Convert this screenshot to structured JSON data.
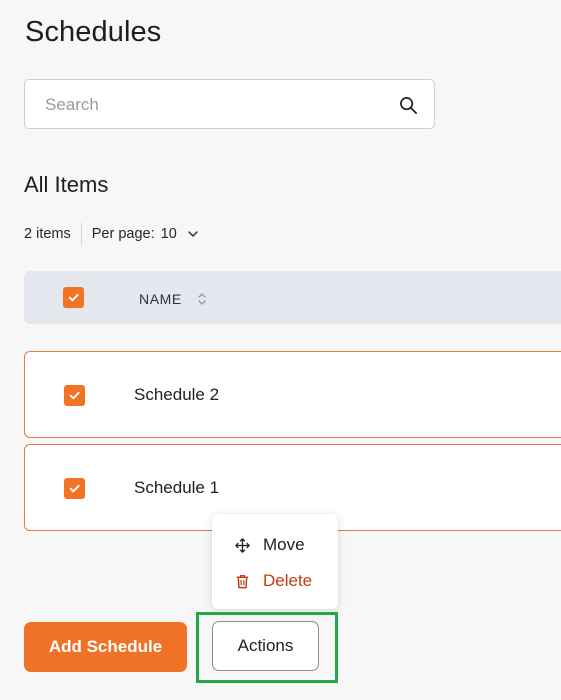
{
  "page": {
    "title": "Schedules"
  },
  "search": {
    "placeholder": "Search",
    "value": "",
    "icon": "search-icon"
  },
  "section": {
    "title": "All Items"
  },
  "pagination": {
    "count_label": "2 items",
    "per_page_label": "Per page:",
    "per_page_value": "10",
    "icon": "chevron-down-icon"
  },
  "table": {
    "header": {
      "name_label": "NAME",
      "select_all_checked": true,
      "sort_icon": "sort-icon"
    },
    "rows": [
      {
        "name": "Schedule 2",
        "checked": true
      },
      {
        "name": "Schedule 1",
        "checked": true
      }
    ]
  },
  "actions_menu": {
    "items": [
      {
        "label": "Move",
        "icon": "move-icon"
      },
      {
        "label": "Delete",
        "icon": "trash-icon",
        "color": "#c23b12"
      }
    ]
  },
  "footer": {
    "add_label": "Add Schedule",
    "actions_label": "Actions"
  },
  "colors": {
    "accent": "#ef7226",
    "highlight": "#23a847",
    "danger": "#c23b12",
    "header_bg": "#e4e7ee"
  }
}
